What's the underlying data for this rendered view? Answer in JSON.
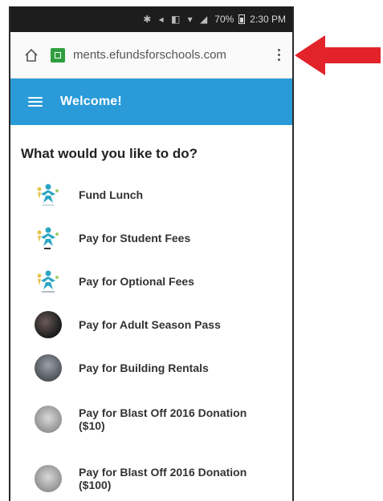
{
  "status_bar": {
    "battery": "70%",
    "time": "2:30 PM"
  },
  "browser": {
    "url": "ments.efundsforschools.com"
  },
  "header": {
    "title": "Welcome!"
  },
  "prompt": "What would you like to do?",
  "items": [
    {
      "label": "Fund Lunch",
      "icon": "lunch-logo-icon"
    },
    {
      "label": "Pay for Student Fees",
      "icon": "fees-logo-icon"
    },
    {
      "label": "Pay for Optional Fees",
      "icon": "optional-fees-logo-icon"
    },
    {
      "label": "Pay for Adult Season Pass",
      "icon": "season-pass-photo-icon"
    },
    {
      "label": "Pay for Building Rentals",
      "icon": "building-photo-icon"
    },
    {
      "label": "Pay for Blast Off 2016 Donation ($10)",
      "icon": "donation-photo-icon"
    },
    {
      "label": "Pay for Blast Off 2016 Donation ($100)",
      "icon": "donation-photo-icon"
    }
  ],
  "colors": {
    "header_bg": "#2a9bd8",
    "arrow": "#e2232a",
    "site_icon": "#2e9e3e"
  }
}
